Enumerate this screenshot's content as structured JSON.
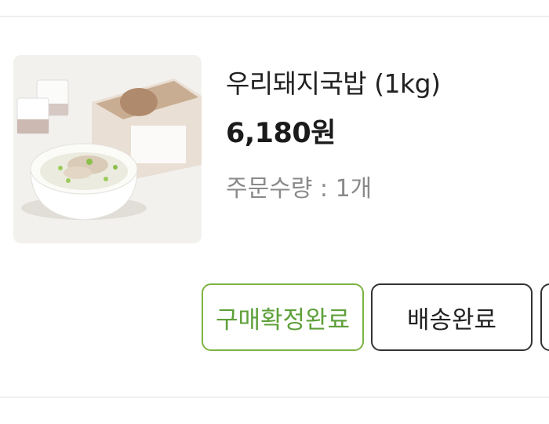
{
  "order_item": {
    "product_name": "우리돼지국밥 (1kg)",
    "price": "6,180원",
    "quantity": "주문수량 : 1개",
    "image_alt": "국밥 제품 이미지"
  },
  "actions": {
    "confirm_label": "구매확정완료",
    "delivered_label": "배송완료",
    "more_label": ""
  },
  "colors": {
    "confirm_accent": "#7cb342",
    "button_border": "#333333",
    "divider": "#eeeeee",
    "muted_text": "#8a8a8a"
  }
}
